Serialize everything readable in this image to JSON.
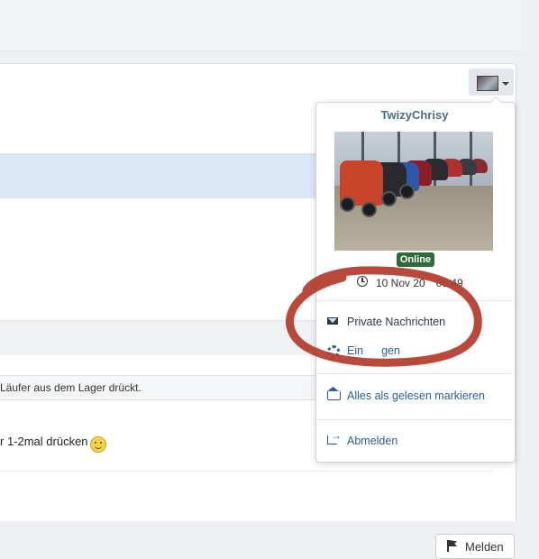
{
  "user_menu": {
    "username": "TwizyChrisy",
    "status_badge": "Online",
    "last_seen": "10 Nov 20     08:49",
    "items": [
      {
        "label": "Private Nachrichten",
        "icon": "envelope-icon"
      },
      {
        "label": "Ein        gen",
        "icon": "gear-icon"
      },
      {
        "label": "Alles als gelesen markieren",
        "icon": "open-envelope-icon"
      },
      {
        "label": "Abmelden",
        "icon": "logout-icon"
      }
    ]
  },
  "post": {
    "quote_snippet": "Läufer aus dem Lager drückt.",
    "body_snippet": "r 1-2mal drücken"
  },
  "footer": {
    "report_label": "Melden"
  },
  "colors": {
    "accent": "#2a5d8f",
    "online": "#2f6b3a",
    "annotation": "#b23a2a"
  }
}
